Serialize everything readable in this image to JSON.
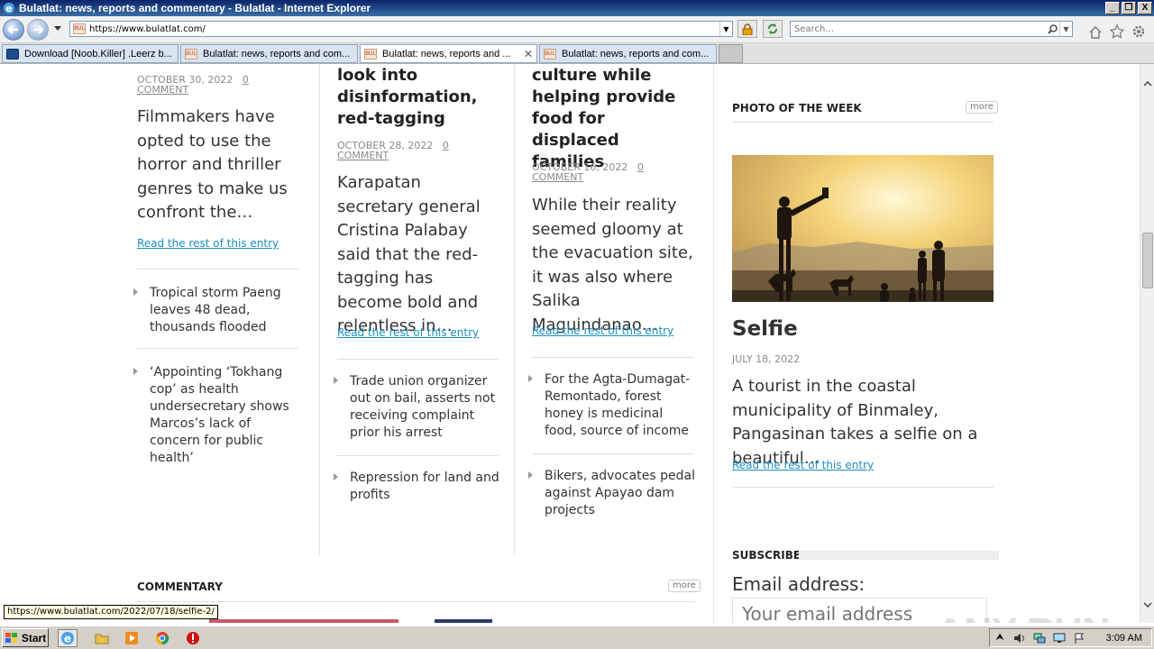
{
  "window": {
    "title": "Bulatlat: news, reports and commentary - Bulatlat - Internet Explorer",
    "minimize": "_",
    "restore": "❐",
    "close": "X"
  },
  "addressbar": {
    "url": "https://www.bulatlat.com/",
    "search_placeholder": "Search..."
  },
  "tabs": [
    {
      "label": "Download [Noob.Killer] .Leerz b...",
      "active": false,
      "favicon": "download"
    },
    {
      "label": "Bulatlat: news, reports and com...",
      "active": false,
      "favicon": "bulatlat"
    },
    {
      "label": "Bulatlat: news, reports and ...",
      "active": true,
      "favicon": "bulatlat"
    },
    {
      "label": "Bulatlat: news, reports and com...",
      "active": false,
      "favicon": "bulatlat"
    }
  ],
  "favicon_text": "BUL",
  "col1": {
    "date": "OCTOBER 30, 2022",
    "comment": "0 COMMENT",
    "excerpt": "Filmmakers have opted to use the horror and thriller genres to make us confront the…",
    "readmore": "Read the rest of this entry",
    "links": [
      "Tropical storm Paeng leaves 48 dead, thousands flooded",
      "‘Appointing ‘Tokhang cop’ as health undersecretary shows Marcos’s lack of concern for public health’"
    ]
  },
  "col2": {
    "headline": "look into disinformation, red-tagging",
    "date": "OCTOBER 28, 2022",
    "comment": "0 COMMENT",
    "excerpt": "Karapatan secretary general Cristina Palabay said that the red-tagging has become bold and relentless in…",
    "readmore": "Read the rest of this entry",
    "links": [
      "Trade union organizer out on bail, asserts not receiving complaint prior his arrest",
      "Repression for land and profits"
    ]
  },
  "col3": {
    "headline": "culture while helping provide food for displaced families",
    "date": "OCTOBER 16, 2022",
    "comment": "0 COMMENT",
    "excerpt": "While their reality seemed gloomy at the evacuation site, it was also where Salika Maguindanao…",
    "readmore": "Read the rest of this entry",
    "links": [
      "For the Agta-Dumagat-Remontado, forest honey is medicinal food, source of income",
      "Bikers, advocates pedal against Apayao dam projects"
    ]
  },
  "photo_week": {
    "section": "PHOTO OF THE WEEK",
    "more": "more",
    "title": "Selfie",
    "date": "JULY 18, 2022",
    "excerpt": "A tourist in the coastal municipality of Binmaley, Pangasinan takes a selfie on a beautiful…",
    "readmore": "Read the rest of this entry"
  },
  "subscribe": {
    "section": "SUBSCRIBE",
    "email_label": "Email address:",
    "email_placeholder": "Your email address"
  },
  "commentary": {
    "section": "COMMENTARY",
    "more": "more"
  },
  "status_url": "https://www.bulatlat.com/2022/07/18/selfie-2/",
  "taskbar": {
    "start": "Start",
    "clock": "3:09 AM"
  },
  "watermark": "ANY RUN"
}
